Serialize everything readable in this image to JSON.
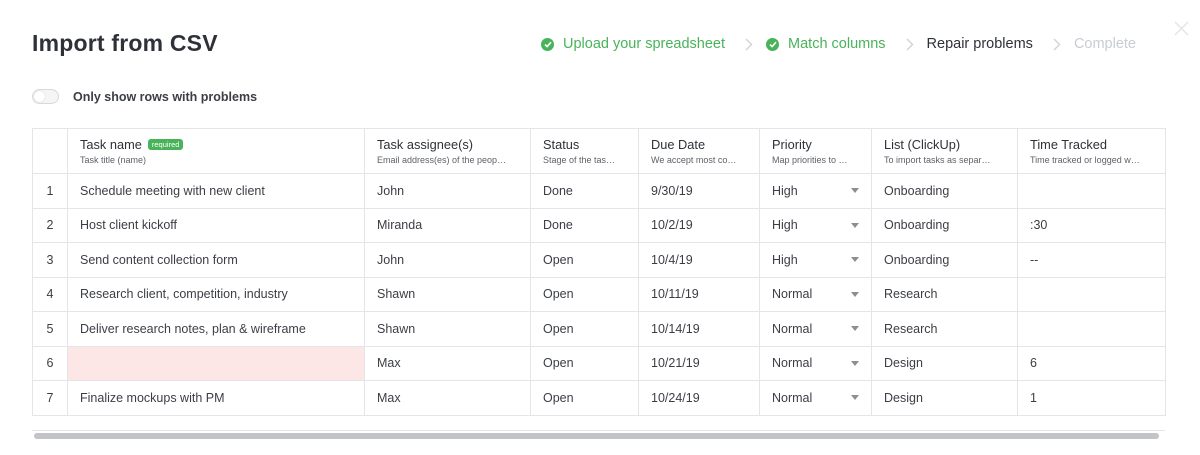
{
  "header": {
    "title": "Import from CSV",
    "steps": [
      {
        "label": "Upload your spreadsheet",
        "state": "done"
      },
      {
        "label": "Match columns",
        "state": "done"
      },
      {
        "label": "Repair problems",
        "state": "current"
      },
      {
        "label": "Complete",
        "state": "todo"
      }
    ]
  },
  "filter": {
    "label": "Only show rows with problems",
    "enabled": false
  },
  "table": {
    "columns": [
      {
        "title": "",
        "subtitle": ""
      },
      {
        "title": "Task name",
        "badge": "required",
        "subtitle": "Task title (name)"
      },
      {
        "title": "Task assignee(s)",
        "subtitle": "Email address(es) of the peop…"
      },
      {
        "title": "Status",
        "subtitle": "Stage of the tas…"
      },
      {
        "title": "Due Date",
        "subtitle": "We accept most co…"
      },
      {
        "title": "Priority",
        "subtitle": "Map priorities to …"
      },
      {
        "title": "List (ClickUp)",
        "subtitle": "To import tasks as separ…"
      },
      {
        "title": "Time Tracked",
        "subtitle": "Time tracked or logged w…"
      }
    ],
    "rows": [
      [
        "1",
        "Schedule meeting with new client",
        "John",
        "Done",
        "9/30/19",
        "High",
        "Onboarding",
        ""
      ],
      [
        "2",
        "Host client kickoff",
        "Miranda",
        "Done",
        "10/2/19",
        "High",
        "Onboarding",
        ":30"
      ],
      [
        "3",
        "Send content collection form",
        "John",
        "Open",
        "10/4/19",
        "High",
        "Onboarding",
        "--"
      ],
      [
        "4",
        "Research client, competition, industry",
        "Shawn",
        "Open",
        "10/11/19",
        "Normal",
        "Research",
        ""
      ],
      [
        "5",
        "Deliver research notes, plan & wireframe",
        "Shawn",
        "Open",
        "10/14/19",
        "Normal",
        "Research",
        ""
      ],
      [
        "6",
        "",
        "Max",
        "Open",
        "10/21/19",
        "Normal",
        "Design",
        "6"
      ],
      [
        "7",
        "Finalize mockups with PM",
        "Max",
        "Open",
        "10/24/19",
        "Normal",
        "Design",
        "1"
      ]
    ],
    "error_cells": [
      {
        "row": 5,
        "col": 1
      }
    ]
  },
  "colors": {
    "success": "#49b35a",
    "error_bg": "#fde6e6",
    "border": "#e3e5e8",
    "pending": "#c9cdd2"
  },
  "icons": {
    "step_done": "check-circle-icon",
    "step_separator": "chevron-right-icon",
    "close": "close-icon",
    "dropdown": "caret-down-icon"
  }
}
